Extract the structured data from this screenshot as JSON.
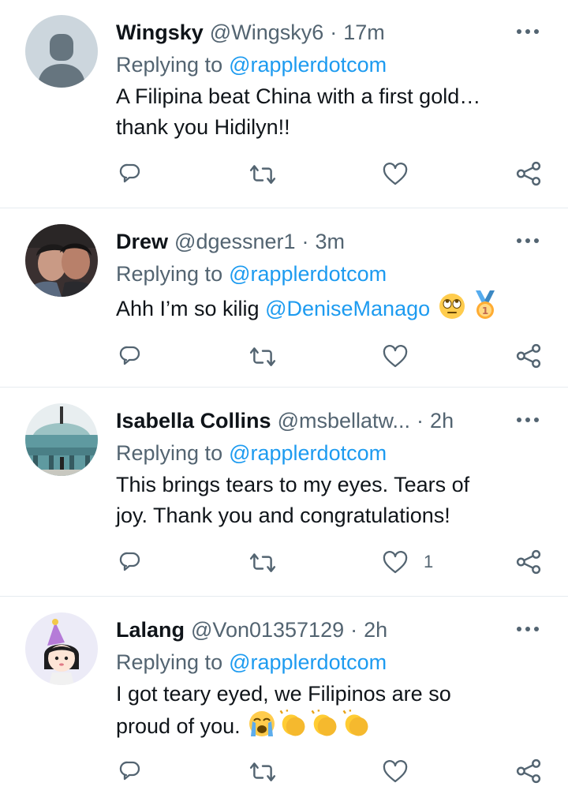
{
  "tweets": [
    {
      "name": "Wingsky",
      "handle": "@Wingsky6",
      "separator": "·",
      "time": "17m",
      "replying_prefix": "Replying to",
      "replying_to": "@rapplerdotcom",
      "text_lines": [
        "A Filipina beat China with a first gold…",
        "thank you Hidilyn!!"
      ],
      "avatar": "default-avatar",
      "like_count": ""
    },
    {
      "name": "Drew",
      "handle": "@dgessner1",
      "separator": "·",
      "time": "3m",
      "replying_prefix": "Replying to",
      "replying_to": "@rapplerdotcom",
      "text": "Ahh I’m so kilig",
      "text_mention": "@DeniseManago",
      "emojis": [
        "rolling-eyes-emoji",
        "gold-medal-emoji"
      ],
      "avatar": "photo-avatar-couple",
      "like_count": ""
    },
    {
      "name": "Isabella Collins",
      "handle": "@msbellatw...",
      "separator": "·",
      "time": "2h",
      "replying_prefix": "Replying to",
      "replying_to": "@rapplerdotcom",
      "text_lines": [
        "This brings tears to my eyes. Tears of",
        "joy. Thank you and congratulations!"
      ],
      "avatar": "photo-avatar-building",
      "like_count": "1"
    },
    {
      "name": "Lalang",
      "handle": "@Von01357129",
      "separator": "·",
      "time": "2h",
      "replying_prefix": "Replying to",
      "replying_to": "@rapplerdotcom",
      "text_lines": [
        "I got teary eyed, we Filipinos are so",
        "proud of you."
      ],
      "emojis": [
        "loudly-crying-emoji",
        "clapping-hands-emoji",
        "clapping-hands-emoji",
        "clapping-hands-emoji"
      ],
      "avatar": "cartoon-girl-party-hat-avatar",
      "like_count": ""
    }
  ],
  "colors": {
    "link": "#1d9bf0",
    "secondary_text": "#536471",
    "primary_text": "#0f1419",
    "divider": "#e6ecf0"
  },
  "icons": {
    "reply": "reply-icon",
    "retweet": "retweet-icon",
    "like": "heart-icon",
    "share": "share-icon",
    "more": "more-icon"
  }
}
